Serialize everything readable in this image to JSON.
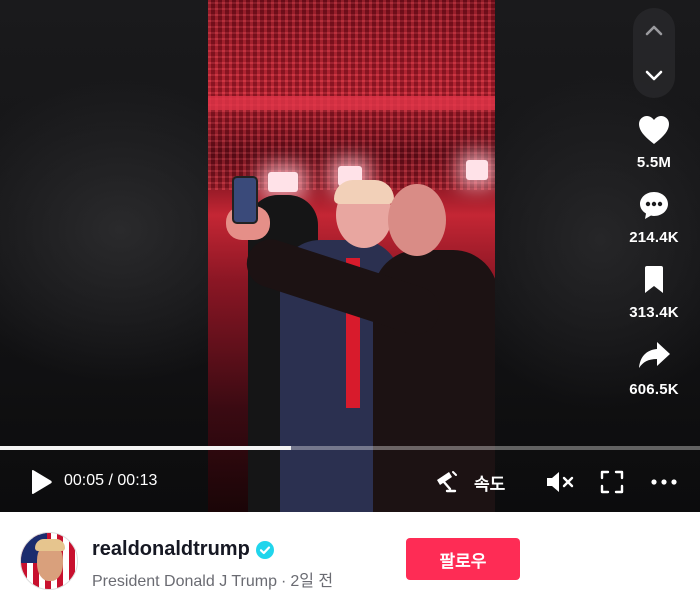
{
  "player": {
    "current_time": "00:05",
    "separator": "/",
    "duration": "00:13",
    "progress": 0.415,
    "speed_label": "속도"
  },
  "actions": {
    "likes": "5.5M",
    "comments": "214.4K",
    "saves": "313.4K",
    "shares": "606.5K"
  },
  "author": {
    "username": "realdonaldtrump",
    "nickname": "President Donald J Trump",
    "dot": "·",
    "posted": "2일 전",
    "follow_label": "팔로우"
  },
  "colors": {
    "accent": "#fe2c55",
    "verified": "#20d5ec",
    "player_bg": "#0b0b0c"
  },
  "icons": [
    "chevron-up-icon",
    "chevron-down-icon",
    "heart-icon",
    "comment-icon",
    "bookmark-icon",
    "share-icon",
    "play-icon",
    "pip-icon",
    "mute-icon",
    "fullscreen-icon",
    "more-icon",
    "verified-icon"
  ]
}
